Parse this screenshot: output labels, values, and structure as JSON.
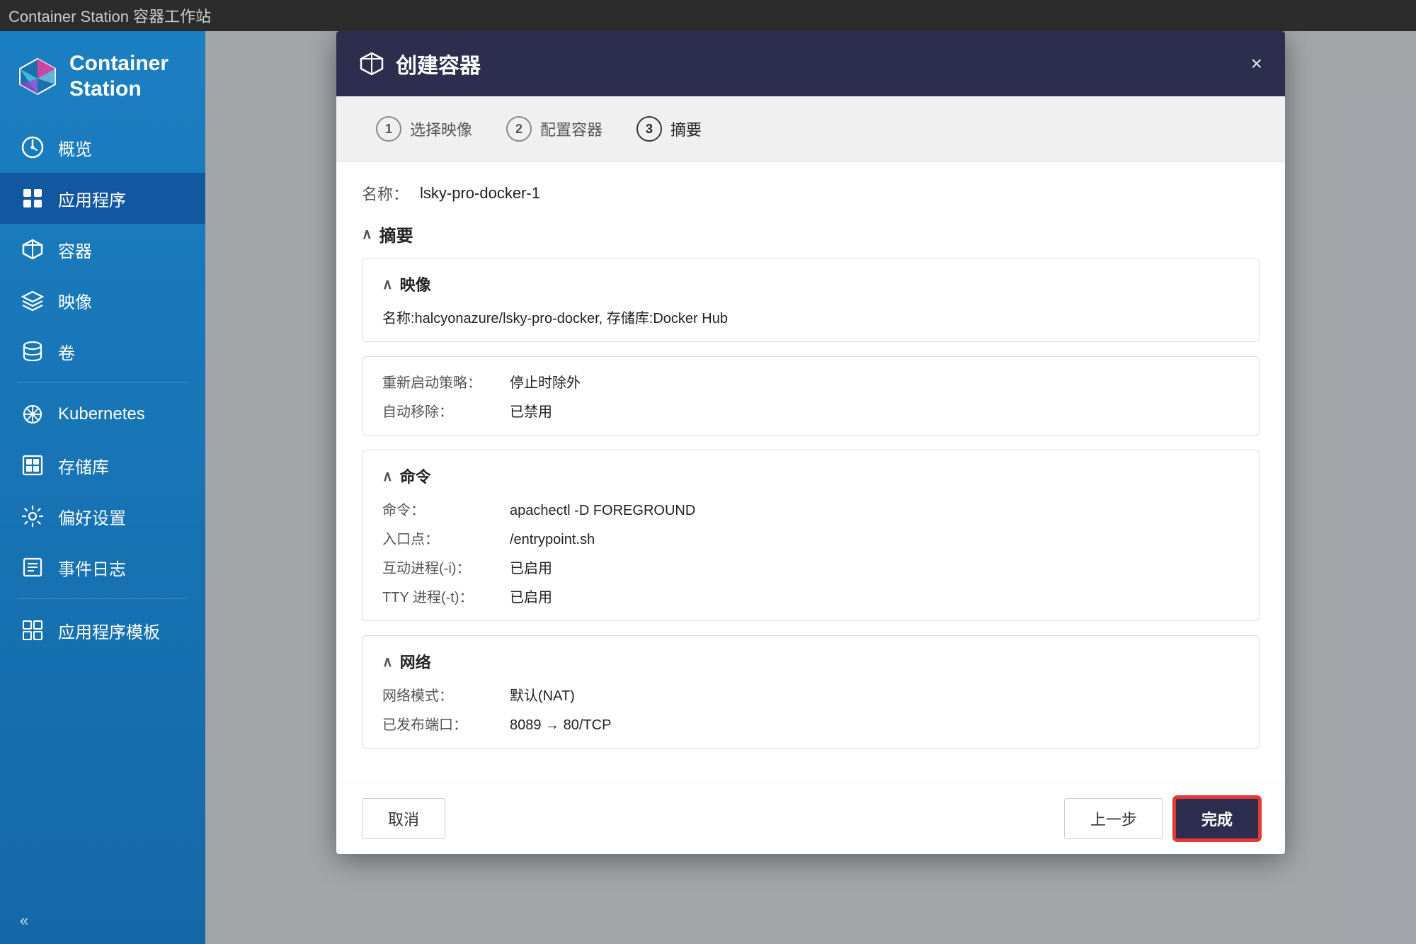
{
  "titleBar": {
    "text": "Container Station 容器工作站"
  },
  "sidebar": {
    "title": "Container Station",
    "items": [
      {
        "id": "overview",
        "label": "概览",
        "icon": "dashboard"
      },
      {
        "id": "applications",
        "label": "应用程序",
        "icon": "apps",
        "active": true
      },
      {
        "id": "containers",
        "label": "容器",
        "icon": "container"
      },
      {
        "id": "images",
        "label": "映像",
        "icon": "layers"
      },
      {
        "id": "volumes",
        "label": "卷",
        "icon": "database"
      },
      {
        "id": "kubernetes",
        "label": "Kubernetes",
        "icon": "kubernetes"
      },
      {
        "id": "registry",
        "label": "存储库",
        "icon": "registry"
      },
      {
        "id": "preferences",
        "label": "偏好设置",
        "icon": "settings"
      },
      {
        "id": "eventlog",
        "label": "事件日志",
        "icon": "eventlog"
      },
      {
        "id": "templates",
        "label": "应用程序模板",
        "icon": "templates"
      }
    ],
    "collapseLabel": "«"
  },
  "modal": {
    "title": "创建容器",
    "closeLabel": "×",
    "steps": [
      {
        "number": "1",
        "label": "选择映像"
      },
      {
        "number": "2",
        "label": "配置容器"
      },
      {
        "number": "3",
        "label": "摘要",
        "active": true
      }
    ],
    "nameLabel": "名称：",
    "nameValue": "lsky-pro-docker-1",
    "sections": {
      "summary": {
        "title": "摘要",
        "toggle": "^"
      },
      "image": {
        "title": "映像",
        "toggle": "^",
        "detail": "名称:halcyonazure/lsky-pro-docker, 存储库:Docker Hub"
      },
      "restartPolicy": {
        "key": "重新启动策略：",
        "value": "停止时除外"
      },
      "autoRemove": {
        "key": "自动移除：",
        "value": "已禁用"
      },
      "command": {
        "title": "命令",
        "toggle": "^",
        "rows": [
          {
            "key": "命令：",
            "value": "apachectl -D FOREGROUND"
          },
          {
            "key": "入口点：",
            "value": "/entrypoint.sh"
          },
          {
            "key": "互动进程(-i)：",
            "value": "已启用"
          },
          {
            "key": "TTY 进程(-t)：",
            "value": "已启用"
          }
        ]
      },
      "network": {
        "title": "网络",
        "toggle": "^",
        "rows": [
          {
            "key": "网络模式：",
            "value": "默认(NAT)"
          },
          {
            "key": "已发布端口：",
            "value": "8089 → 80/TCP"
          }
        ]
      }
    },
    "footer": {
      "cancelLabel": "取消",
      "prevLabel": "上一步",
      "finishLabel": "完成"
    }
  }
}
